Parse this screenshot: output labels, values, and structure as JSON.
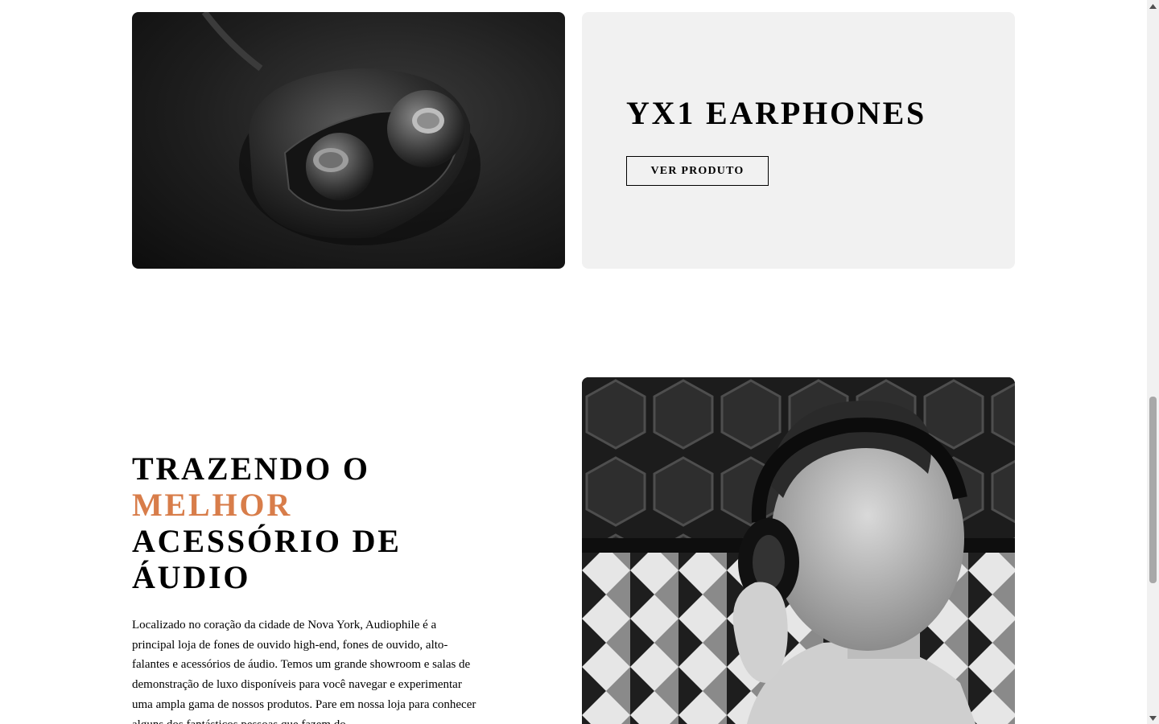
{
  "product": {
    "title": "YX1 EARPHONES",
    "button_label": "VER PRODUTO",
    "image_label": "YX1 earphones in charging case"
  },
  "about": {
    "heading_before": "TRAZENDO O ",
    "heading_accent": "MELHOR",
    "heading_after": " ACESSÓRIO DE ÁUDIO",
    "body": "Localizado no coração da cidade de Nova York, Audiophile é a principal loja de fones de ouvido high-end, fones de ouvido, alto-falantes e acessórios de áudio. Temos um grande showroom e salas de demonstração de luxo disponíveis para você navegar e experimentar uma ampla gama de nossos produtos. Pare em nossa loja para conhecer alguns dos fantásticos pessoas que fazem do",
    "image_label": "Man wearing headphones"
  },
  "colors": {
    "accent": "#d87d4a",
    "panel_bg": "#f1f1f1"
  }
}
